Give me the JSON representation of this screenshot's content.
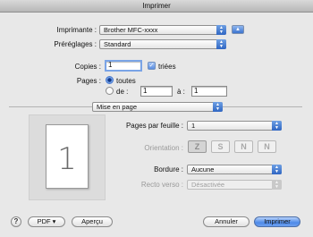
{
  "window": {
    "title": "Imprimer"
  },
  "printer": {
    "label": "Imprimante :",
    "value": "Brother MFC-xxxx",
    "expand_icon": "triangle-up-icon"
  },
  "presets": {
    "label": "Préréglages :",
    "value": "Standard"
  },
  "copies": {
    "label": "Copies :",
    "value": "1",
    "collated_label": "triées",
    "collated_checked": true
  },
  "pages": {
    "label": "Pages :",
    "all_label": "toutes",
    "from_label": "de :",
    "from_value": "1",
    "to_label": "à :",
    "to_value": "1",
    "selected": "all"
  },
  "section_popup": {
    "value": "Mise en page"
  },
  "layout": {
    "preview_number": "1",
    "pages_per_sheet": {
      "label": "Pages par feuille :",
      "value": "1"
    },
    "orientation": {
      "label": "Orientation :",
      "options": [
        "Z",
        "S",
        "N",
        "N"
      ]
    },
    "border": {
      "label": "Bordure :",
      "value": "Aucune"
    },
    "duplex": {
      "label": "Recto verso :",
      "value": "Désactivée"
    }
  },
  "footer": {
    "help": "?",
    "pdf": "PDF ▾",
    "preview": "Aperçu",
    "cancel": "Annuler",
    "print": "Imprimer"
  }
}
